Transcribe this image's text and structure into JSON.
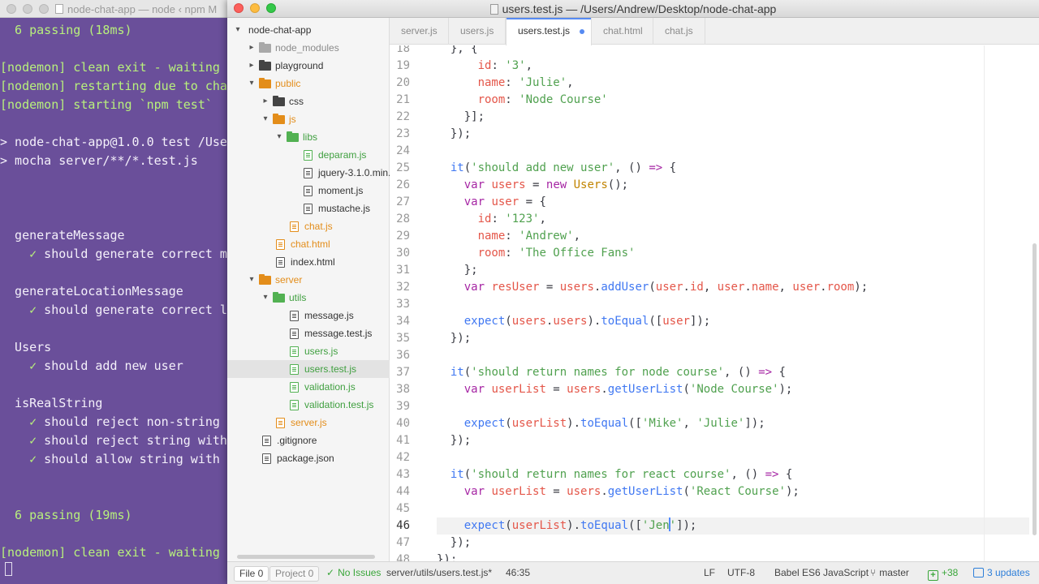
{
  "terminal": {
    "title": "node-chat-app — node ‹ npm M",
    "lines": [
      {
        "text": "  6 passing (18ms)",
        "style": "green"
      },
      {
        "text": "",
        "style": ""
      },
      {
        "text": "[nodemon] clean exit - waiting",
        "style": "green"
      },
      {
        "text": "[nodemon] restarting due to cha",
        "style": "green"
      },
      {
        "text": "[nodemon] starting `npm test`",
        "style": "green"
      },
      {
        "text": "",
        "style": ""
      },
      {
        "text": "> node-chat-app@1.0.0 test /Use",
        "style": ""
      },
      {
        "text": "> mocha server/**/*.test.js",
        "style": ""
      },
      {
        "text": "",
        "style": ""
      },
      {
        "text": "",
        "style": ""
      },
      {
        "text": "",
        "style": ""
      },
      {
        "text": "  generateMessage",
        "style": ""
      },
      {
        "text": "    ✓ should generate correct m",
        "style": "pass"
      },
      {
        "text": "",
        "style": ""
      },
      {
        "text": "  generateLocationMessage",
        "style": ""
      },
      {
        "text": "    ✓ should generate correct l",
        "style": "pass"
      },
      {
        "text": "",
        "style": ""
      },
      {
        "text": "  Users",
        "style": ""
      },
      {
        "text": "    ✓ should add new user",
        "style": "pass"
      },
      {
        "text": "",
        "style": ""
      },
      {
        "text": "  isRealString",
        "style": ""
      },
      {
        "text": "    ✓ should reject non-string",
        "style": "pass"
      },
      {
        "text": "    ✓ should reject string with",
        "style": "pass"
      },
      {
        "text": "    ✓ should allow string with",
        "style": "pass"
      },
      {
        "text": "",
        "style": ""
      },
      {
        "text": "",
        "style": ""
      },
      {
        "text": "  6 passing (19ms)",
        "style": "green"
      },
      {
        "text": "",
        "style": ""
      },
      {
        "text": "[nodemon] clean exit - waiting",
        "style": "green"
      }
    ]
  },
  "window": {
    "title": "users.test.js — /Users/Andrew/Desktop/node-chat-app"
  },
  "tree": {
    "items": [
      {
        "label": "node-chat-app",
        "depth": 0,
        "kind": "root",
        "chevron": "open",
        "color": ""
      },
      {
        "label": "node_modules",
        "depth": 1,
        "kind": "folder",
        "chevron": "closed",
        "color": "grey"
      },
      {
        "label": "playground",
        "depth": 1,
        "kind": "folder",
        "chevron": "closed",
        "color": "dark"
      },
      {
        "label": "public",
        "depth": 1,
        "kind": "folder",
        "chevron": "open",
        "color": "orange"
      },
      {
        "label": "css",
        "depth": 2,
        "kind": "folder",
        "chevron": "closed",
        "color": "dark"
      },
      {
        "label": "js",
        "depth": 2,
        "kind": "folder",
        "chevron": "open",
        "color": "orange"
      },
      {
        "label": "libs",
        "depth": 3,
        "kind": "folder",
        "chevron": "open",
        "color": "green"
      },
      {
        "label": "deparam.js",
        "depth": 4,
        "kind": "file",
        "chevron": "",
        "color": "green"
      },
      {
        "label": "jquery-3.1.0.min.",
        "depth": 4,
        "kind": "file",
        "chevron": "",
        "color": ""
      },
      {
        "label": "moment.js",
        "depth": 4,
        "kind": "file",
        "chevron": "",
        "color": ""
      },
      {
        "label": "mustache.js",
        "depth": 4,
        "kind": "file",
        "chevron": "",
        "color": ""
      },
      {
        "label": "chat.js",
        "depth": 3,
        "kind": "file",
        "chevron": "",
        "color": "orange"
      },
      {
        "label": "chat.html",
        "depth": 2,
        "kind": "file",
        "chevron": "",
        "color": "orange"
      },
      {
        "label": "index.html",
        "depth": 2,
        "kind": "file",
        "chevron": "",
        "color": ""
      },
      {
        "label": "server",
        "depth": 1,
        "kind": "folder",
        "chevron": "open",
        "color": "orange"
      },
      {
        "label": "utils",
        "depth": 2,
        "kind": "folder",
        "chevron": "open",
        "color": "green"
      },
      {
        "label": "message.js",
        "depth": 3,
        "kind": "file",
        "chevron": "",
        "color": ""
      },
      {
        "label": "message.test.js",
        "depth": 3,
        "kind": "file",
        "chevron": "",
        "color": ""
      },
      {
        "label": "users.js",
        "depth": 3,
        "kind": "file",
        "chevron": "",
        "color": "green"
      },
      {
        "label": "users.test.js",
        "depth": 3,
        "kind": "file",
        "chevron": "",
        "color": "green",
        "selected": true
      },
      {
        "label": "validation.js",
        "depth": 3,
        "kind": "file",
        "chevron": "",
        "color": "green"
      },
      {
        "label": "validation.test.js",
        "depth": 3,
        "kind": "file",
        "chevron": "",
        "color": "green"
      },
      {
        "label": "server.js",
        "depth": 2,
        "kind": "file",
        "chevron": "",
        "color": "orange"
      },
      {
        "label": ".gitignore",
        "depth": 1,
        "kind": "file",
        "chevron": "",
        "color": ""
      },
      {
        "label": "package.json",
        "depth": 1,
        "kind": "file",
        "chevron": "",
        "color": ""
      }
    ]
  },
  "tabs": [
    {
      "label": "server.js",
      "active": false,
      "modified": false
    },
    {
      "label": "users.js",
      "active": false,
      "modified": false
    },
    {
      "label": "users.test.js",
      "active": true,
      "modified": true
    },
    {
      "label": "chat.html",
      "active": false,
      "modified": false
    },
    {
      "label": "chat.js",
      "active": false,
      "modified": false
    }
  ],
  "editor": {
    "current_line": 46,
    "lines": [
      {
        "n": 18,
        "tokens": [
          [
            "p",
            "  }, {"
          ]
        ]
      },
      {
        "n": 19,
        "tokens": [
          [
            "v",
            "      id"
          ],
          [
            "p",
            ": "
          ],
          [
            "s",
            "'3'"
          ],
          [
            "p",
            ","
          ]
        ]
      },
      {
        "n": 20,
        "tokens": [
          [
            "v",
            "      name"
          ],
          [
            "p",
            ": "
          ],
          [
            "s",
            "'Julie'"
          ],
          [
            "p",
            ","
          ]
        ]
      },
      {
        "n": 21,
        "tokens": [
          [
            "v",
            "      room"
          ],
          [
            "p",
            ": "
          ],
          [
            "s",
            "'Node Course'"
          ]
        ]
      },
      {
        "n": 22,
        "tokens": [
          [
            "p",
            "    }];"
          ]
        ]
      },
      {
        "n": 23,
        "tokens": [
          [
            "p",
            "  });"
          ]
        ]
      },
      {
        "n": 24,
        "tokens": []
      },
      {
        "n": 25,
        "tokens": [
          [
            "f",
            "  it"
          ],
          [
            "p",
            "("
          ],
          [
            "s",
            "'should add new user'"
          ],
          [
            "p",
            ", () "
          ],
          [
            "k",
            "=>"
          ],
          [
            "p",
            " {"
          ]
        ]
      },
      {
        "n": 26,
        "tokens": [
          [
            "k",
            "    var "
          ],
          [
            "v",
            "users"
          ],
          [
            "p",
            " = "
          ],
          [
            "k",
            "new "
          ],
          [
            "t",
            "Users"
          ],
          [
            "p",
            "();"
          ]
        ]
      },
      {
        "n": 27,
        "tokens": [
          [
            "k",
            "    var "
          ],
          [
            "v",
            "user"
          ],
          [
            "p",
            " = {"
          ]
        ]
      },
      {
        "n": 28,
        "tokens": [
          [
            "v",
            "      id"
          ],
          [
            "p",
            ": "
          ],
          [
            "s",
            "'123'"
          ],
          [
            "p",
            ","
          ]
        ]
      },
      {
        "n": 29,
        "tokens": [
          [
            "v",
            "      name"
          ],
          [
            "p",
            ": "
          ],
          [
            "s",
            "'Andrew'"
          ],
          [
            "p",
            ","
          ]
        ]
      },
      {
        "n": 30,
        "tokens": [
          [
            "v",
            "      room"
          ],
          [
            "p",
            ": "
          ],
          [
            "s",
            "'The Office Fans'"
          ]
        ]
      },
      {
        "n": 31,
        "tokens": [
          [
            "p",
            "    };"
          ]
        ]
      },
      {
        "n": 32,
        "tokens": [
          [
            "k",
            "    var "
          ],
          [
            "v",
            "resUser"
          ],
          [
            "p",
            " = "
          ],
          [
            "v",
            "users"
          ],
          [
            "p",
            "."
          ],
          [
            "f",
            "addUser"
          ],
          [
            "p",
            "("
          ],
          [
            "v",
            "user"
          ],
          [
            "p",
            "."
          ],
          [
            "v",
            "id"
          ],
          [
            "p",
            ", "
          ],
          [
            "v",
            "user"
          ],
          [
            "p",
            "."
          ],
          [
            "v",
            "name"
          ],
          [
            "p",
            ", "
          ],
          [
            "v",
            "user"
          ],
          [
            "p",
            "."
          ],
          [
            "v",
            "room"
          ],
          [
            "p",
            ");"
          ]
        ]
      },
      {
        "n": 33,
        "tokens": []
      },
      {
        "n": 34,
        "tokens": [
          [
            "f",
            "    expect"
          ],
          [
            "p",
            "("
          ],
          [
            "v",
            "users"
          ],
          [
            "p",
            "."
          ],
          [
            "v",
            "users"
          ],
          [
            "p",
            ")."
          ],
          [
            "f",
            "toEqual"
          ],
          [
            "p",
            "(["
          ],
          [
            "v",
            "user"
          ],
          [
            "p",
            "]);"
          ]
        ]
      },
      {
        "n": 35,
        "tokens": [
          [
            "p",
            "  });"
          ]
        ]
      },
      {
        "n": 36,
        "tokens": []
      },
      {
        "n": 37,
        "tokens": [
          [
            "f",
            "  it"
          ],
          [
            "p",
            "("
          ],
          [
            "s",
            "'should return names for node course'"
          ],
          [
            "p",
            ", () "
          ],
          [
            "k",
            "=>"
          ],
          [
            "p",
            " {"
          ]
        ]
      },
      {
        "n": 38,
        "tokens": [
          [
            "k",
            "    var "
          ],
          [
            "v",
            "userList"
          ],
          [
            "p",
            " = "
          ],
          [
            "v",
            "users"
          ],
          [
            "p",
            "."
          ],
          [
            "f",
            "getUserList"
          ],
          [
            "p",
            "("
          ],
          [
            "s",
            "'Node Course'"
          ],
          [
            "p",
            ");"
          ]
        ]
      },
      {
        "n": 39,
        "tokens": []
      },
      {
        "n": 40,
        "tokens": [
          [
            "f",
            "    expect"
          ],
          [
            "p",
            "("
          ],
          [
            "v",
            "userList"
          ],
          [
            "p",
            ")."
          ],
          [
            "f",
            "toEqual"
          ],
          [
            "p",
            "(["
          ],
          [
            "s",
            "'Mike'"
          ],
          [
            "p",
            ", "
          ],
          [
            "s",
            "'Julie'"
          ],
          [
            "p",
            "]);"
          ]
        ]
      },
      {
        "n": 41,
        "tokens": [
          [
            "p",
            "  });"
          ]
        ]
      },
      {
        "n": 42,
        "tokens": []
      },
      {
        "n": 43,
        "tokens": [
          [
            "f",
            "  it"
          ],
          [
            "p",
            "("
          ],
          [
            "s",
            "'should return names for react course'"
          ],
          [
            "p",
            ", () "
          ],
          [
            "k",
            "=>"
          ],
          [
            "p",
            " {"
          ]
        ]
      },
      {
        "n": 44,
        "tokens": [
          [
            "k",
            "    var "
          ],
          [
            "v",
            "userList"
          ],
          [
            "p",
            " = "
          ],
          [
            "v",
            "users"
          ],
          [
            "p",
            "."
          ],
          [
            "f",
            "getUserList"
          ],
          [
            "p",
            "("
          ],
          [
            "s",
            "'React Course'"
          ],
          [
            "p",
            ");"
          ]
        ]
      },
      {
        "n": 45,
        "tokens": []
      },
      {
        "n": 46,
        "tokens": [
          [
            "f",
            "    expect"
          ],
          [
            "p",
            "("
          ],
          [
            "v",
            "userList"
          ],
          [
            "p",
            ")."
          ],
          [
            "f",
            "toEqual"
          ],
          [
            "p",
            "(["
          ],
          [
            "s",
            "'Jen"
          ],
          [
            "caret",
            ""
          ],
          [
            "s",
            "'"
          ],
          [
            "p",
            "]);"
          ]
        ]
      },
      {
        "n": 47,
        "tokens": [
          [
            "p",
            "  });"
          ]
        ]
      },
      {
        "n": 48,
        "tokens": [
          [
            "p",
            "});"
          ]
        ]
      }
    ]
  },
  "status": {
    "file_label": "File 0",
    "project_label": "Project 0",
    "no_issues": "No Issues",
    "path": "server/utils/users.test.js*",
    "cursor": "46:35",
    "line_ending": "LF",
    "encoding": "UTF-8",
    "grammar": "Babel ES6 JavaScript",
    "branch": "master",
    "diff": "+38",
    "updates": "3 updates"
  },
  "colors": {
    "accent": "#568af2",
    "folder_orange": "#e38d1a",
    "folder_green": "#52b152",
    "terminal_bg": "#6a4f9a"
  }
}
